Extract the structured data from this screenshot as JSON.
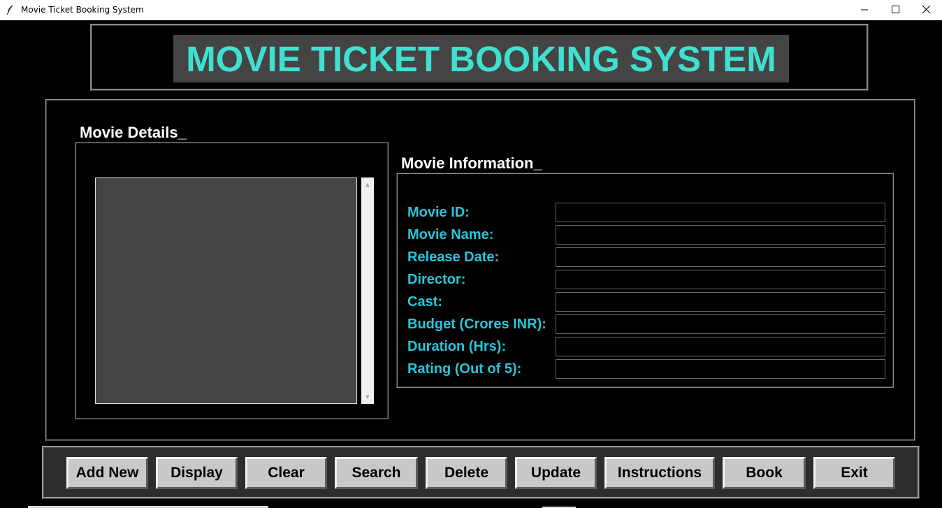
{
  "window": {
    "title": "Movie Ticket Booking System",
    "controls": {
      "minimize": "minimize-icon",
      "maximize": "maximize-icon",
      "close": "close-icon"
    }
  },
  "header": {
    "title": "MOVIE TICKET BOOKING SYSTEM"
  },
  "details": {
    "label": "Movie Details_"
  },
  "info": {
    "label": "Movie Information_",
    "fields": [
      {
        "label": "Movie ID:",
        "value": ""
      },
      {
        "label": "Movie Name:",
        "value": ""
      },
      {
        "label": "Release Date:",
        "value": ""
      },
      {
        "label": "Director:",
        "value": ""
      },
      {
        "label": "Cast:",
        "value": ""
      },
      {
        "label": "Budget (Crores INR):",
        "value": ""
      },
      {
        "label": "Duration (Hrs):",
        "value": ""
      },
      {
        "label": "Rating (Out of 5):",
        "value": ""
      }
    ]
  },
  "buttons": [
    "Add New",
    "Display",
    "Clear",
    "Search",
    "Delete",
    "Update",
    "Instructions",
    "Book",
    "Exit"
  ],
  "colors": {
    "title_text": "#40e0d0",
    "title_bg": "#444444",
    "field_label": "#26c6da",
    "listbox_bg": "#444444",
    "button_bg": "#c8c8c8",
    "background": "#000000"
  }
}
